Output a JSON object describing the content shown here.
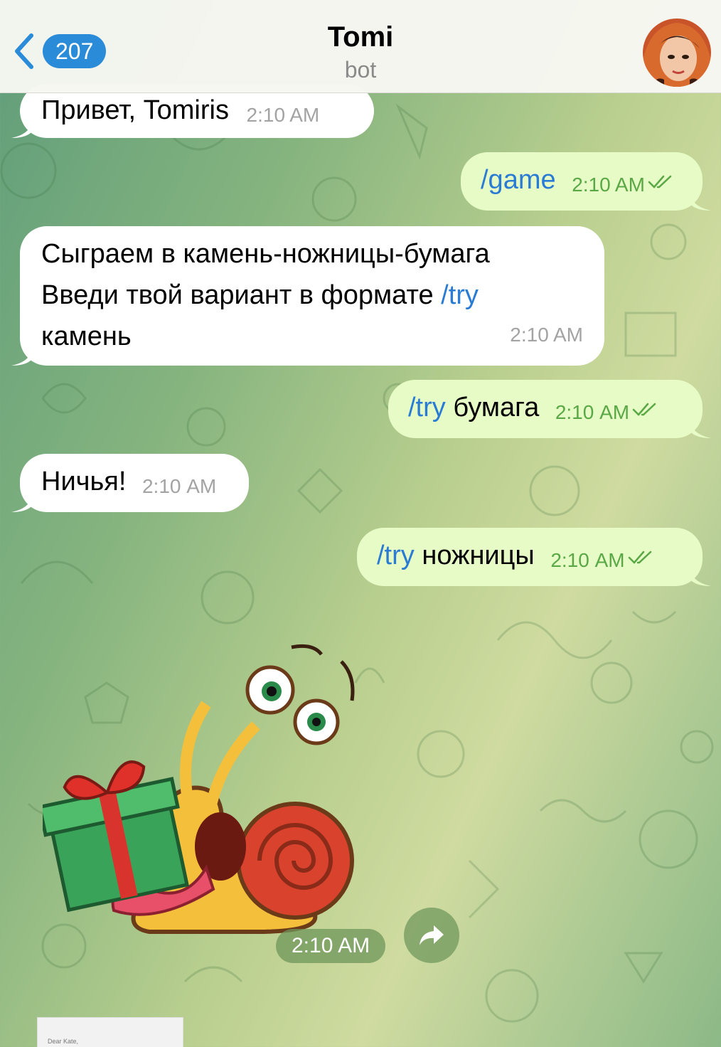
{
  "header": {
    "back_count": "207",
    "title": "Tomi",
    "subtitle": "bot",
    "icons": [
      "chevron-left-icon",
      "avatar"
    ]
  },
  "messages": [
    {
      "direction": "in",
      "parts": [
        {
          "text": "Привет, Tomiris"
        }
      ],
      "time": "2:10 AM"
    },
    {
      "direction": "out",
      "parts": [
        {
          "text": "/game",
          "link": true
        }
      ],
      "time": "2:10 AM",
      "read": true
    },
    {
      "direction": "in",
      "lines": [
        "Сыграем в камень-ножницы-бумага",
        "Введи твой вариант в формате ",
        "/try",
        "камень"
      ],
      "time": "2:10 AM"
    },
    {
      "direction": "out",
      "parts": [
        {
          "text": "/try",
          "link": true
        },
        {
          "text": " бумага"
        }
      ],
      "time": "2:10 AM",
      "read": true
    },
    {
      "direction": "in",
      "parts": [
        {
          "text": "Ничья!"
        }
      ],
      "time": "2:10 AM"
    },
    {
      "direction": "out",
      "parts": [
        {
          "text": "/try",
          "link": true
        },
        {
          "text": " ножницы"
        }
      ],
      "time": "2:10 AM",
      "read": true
    },
    {
      "direction": "in",
      "type": "sticker",
      "sticker": "snail-with-gift",
      "time": "2:10 AM"
    }
  ],
  "thumbnail_text": "Dear Kate,",
  "colors": {
    "link": "#2a7bd4",
    "badge": "#2a8bd8",
    "out_bubble": "#e6fbc6",
    "out_time": "#5aa845",
    "in_time": "#a3a3a3"
  }
}
